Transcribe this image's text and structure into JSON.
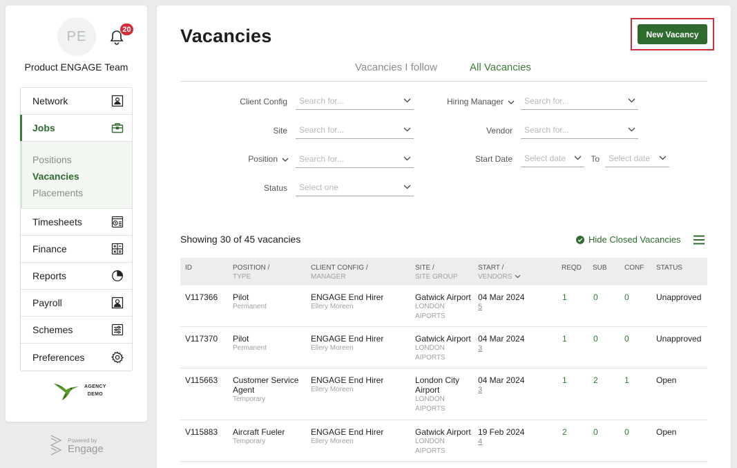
{
  "user": {
    "initials": "PE",
    "team": "Product ENGAGE Team",
    "notifications": "20"
  },
  "nav": {
    "network": "Network",
    "jobs": "Jobs",
    "jobs_sub": [
      "Positions",
      "Vacancies",
      "Placements"
    ],
    "timesheets": "Timesheets",
    "finance": "Finance",
    "reports": "Reports",
    "payroll": "Payroll",
    "schemes": "Schemes",
    "preferences": "Preferences"
  },
  "brand": {
    "line1": "AGENCY",
    "line2": "DEMO"
  },
  "powered": {
    "label": "Powered by",
    "name": "Engage"
  },
  "page": {
    "title": "Vacancies",
    "new_button": "New Vacancy"
  },
  "tabs": [
    "Vacancies I follow",
    "All Vacancies"
  ],
  "filters": {
    "client_config": {
      "label": "Client Config",
      "placeholder": "Search for..."
    },
    "site": {
      "label": "Site",
      "placeholder": "Search for..."
    },
    "position": {
      "label": "Position",
      "placeholder": "Search for..."
    },
    "status": {
      "label": "Status",
      "placeholder": "Select one"
    },
    "hiring_manager": {
      "label": "Hiring Manager",
      "placeholder": "Search for..."
    },
    "vendor": {
      "label": "Vendor",
      "placeholder": "Search for..."
    },
    "start_date": {
      "label": "Start Date",
      "placeholder": "Select date"
    },
    "to": {
      "label": "To",
      "placeholder": "Select date"
    }
  },
  "list": {
    "showing": "Showing 30 of 45 vacancies",
    "hide_closed": "Hide Closed Vacancies"
  },
  "table": {
    "headers": {
      "id": "ID",
      "position": "POSITION /",
      "position_sub": "TYPE",
      "client": "CLIENT CONFIG /",
      "client_sub": "MANAGER",
      "site": "SITE /",
      "site_sub": "SITE GROUP",
      "start": "START /",
      "start_sub": "VENDORS",
      "reqd": "REQD",
      "sub": "SUB",
      "conf": "CONF",
      "status": "STATUS"
    },
    "rows": [
      {
        "id": "V117366",
        "position": "Pilot",
        "type": "Permanent",
        "client": "ENGAGE End Hirer",
        "manager": "Ellery Moreen",
        "site": "Gatwick Airport",
        "site_group_1": "LONDON",
        "site_group_2": "AIPORTS",
        "start": "04 Mar 2024",
        "vendors": "5",
        "reqd": "1",
        "sub": "0",
        "conf": "0",
        "status": "Unapproved"
      },
      {
        "id": "V117370",
        "position": "Pilot",
        "type": "Permanent",
        "client": "ENGAGE End Hirer",
        "manager": "Ellery Moreen",
        "site": "Gatwick Airport",
        "site_group_1": "LONDON",
        "site_group_2": "AIPORTS",
        "start": "04 Mar 2024",
        "vendors": "3",
        "reqd": "1",
        "sub": "0",
        "conf": "0",
        "status": "Unapproved"
      },
      {
        "id": "V115663",
        "position": "Customer Service",
        "position_2": "Agent",
        "type": "Temporary",
        "client": "ENGAGE End Hirer",
        "manager": "Ellery Moreen",
        "site": "London City",
        "site_2": "Airport",
        "site_group_1": "LONDON",
        "site_group_2": "AIPORTS",
        "start": "04 Mar 2024",
        "vendors": "3",
        "reqd": "1",
        "sub": "2",
        "conf": "1",
        "status": "Open"
      },
      {
        "id": "V115883",
        "position": "Aircraft Fueler",
        "type": "Temporary",
        "client": "ENGAGE End Hirer",
        "manager": "Ellery Moreen",
        "site": "Gatwick Airport",
        "site_group_1": "LONDON",
        "site_group_2": "AIPORTS",
        "start": "19 Feb 2024",
        "vendors": "4",
        "reqd": "2",
        "sub": "0",
        "conf": "0",
        "status": "Open"
      }
    ]
  },
  "colors": {
    "accent": "#2f6b2f",
    "badge": "#d32d3a",
    "highlight": "#d32d3a"
  },
  "icons": [
    "bell-icon",
    "contact-card-icon",
    "briefcase-icon",
    "timesheet-icon",
    "calculator-icon",
    "pie-chart-icon",
    "person-card-icon",
    "sliders-icon",
    "gear-icon",
    "check-circle-icon",
    "hamburger-menu-icon",
    "chevron-down-icon"
  ]
}
